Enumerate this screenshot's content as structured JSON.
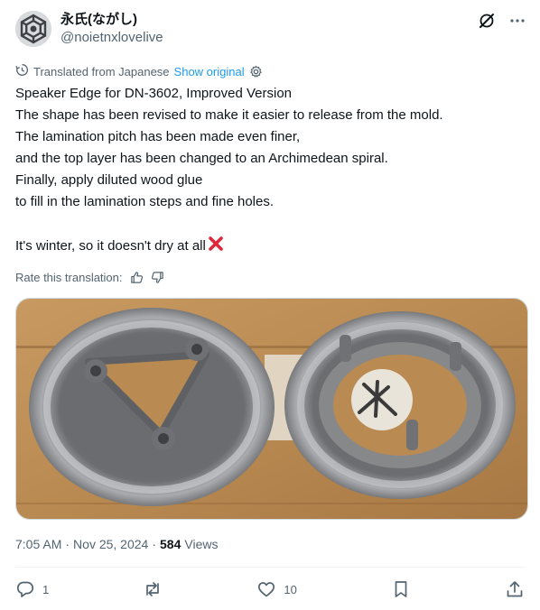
{
  "author": {
    "display_name": "永氏(ながし)",
    "handle": "@noietnxlovelive"
  },
  "translation": {
    "label": "Translated from Japanese",
    "show_original": "Show original"
  },
  "post_text": [
    "Speaker Edge for DN-3602, Improved Version",
    "The shape has been revised to make it easier to release from the mold.",
    "The lamination pitch has been made even finer,",
    "and the top layer has been changed to an Archimedean spiral.",
    "Finally, apply diluted wood glue",
    "to fill in the lamination steps and fine holes.",
    "",
    "It's winter, so it doesn't dry at all"
  ],
  "rate": {
    "label": "Rate this translation:"
  },
  "meta": {
    "time": "7:05 AM",
    "separator": "·",
    "date": "Nov 25, 2024",
    "views_count": "584",
    "views_label": "Views"
  },
  "actions": {
    "reply_count": "1",
    "like_count": "10"
  },
  "colors": {
    "accent": "#1d9bf0",
    "text_secondary": "#536471",
    "cross_mark": "#e0283c"
  },
  "icons": [
    "grok-icon",
    "more-icon",
    "translate-icon",
    "settings-icon",
    "thumbs-up-icon",
    "thumbs-down-icon",
    "reply-icon",
    "repost-icon",
    "like-icon",
    "bookmark-icon",
    "share-icon",
    "cross-mark-icon"
  ]
}
